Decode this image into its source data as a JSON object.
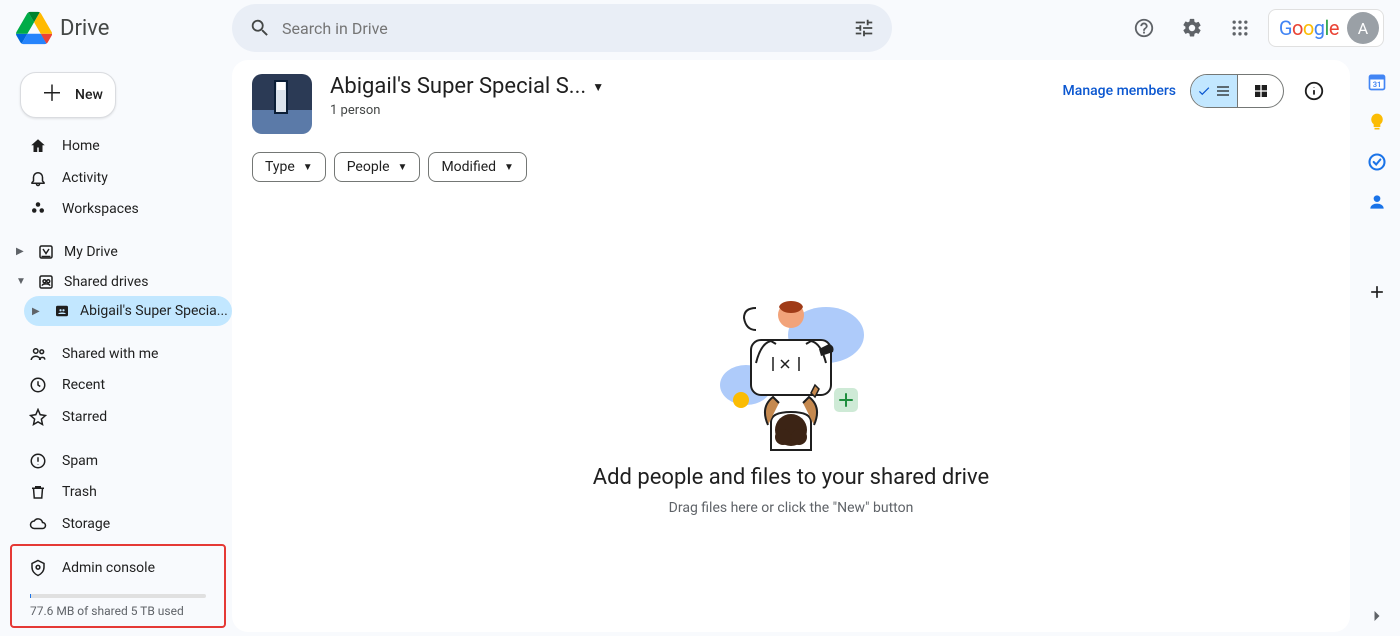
{
  "brand": {
    "name": "Drive"
  },
  "search": {
    "placeholder": "Search in Drive"
  },
  "header_profile": {
    "label": "Google",
    "initial": "A"
  },
  "sidebar": {
    "new_label": "New",
    "nav1": [
      {
        "label": "Home"
      },
      {
        "label": "Activity"
      },
      {
        "label": "Workspaces"
      }
    ],
    "tree": {
      "my_drive": "My Drive",
      "shared_drives": "Shared drives",
      "current_drive": "Abigail's Super Specia..."
    },
    "nav2": [
      {
        "label": "Shared with me"
      },
      {
        "label": "Recent"
      },
      {
        "label": "Starred"
      }
    ],
    "nav3": [
      {
        "label": "Spam"
      },
      {
        "label": "Trash"
      },
      {
        "label": "Storage"
      }
    ],
    "admin_label": "Admin console",
    "storage_text": "77.6 MB of shared 5 TB used"
  },
  "content": {
    "title": "Abigail's Super Special S...",
    "subtitle": "1 person",
    "manage_label": "Manage members",
    "filters": [
      {
        "label": "Type"
      },
      {
        "label": "People"
      },
      {
        "label": "Modified"
      }
    ],
    "empty_title": "Add people and files to your shared drive",
    "empty_subtitle": "Drag files here or click the \"New\" button"
  }
}
